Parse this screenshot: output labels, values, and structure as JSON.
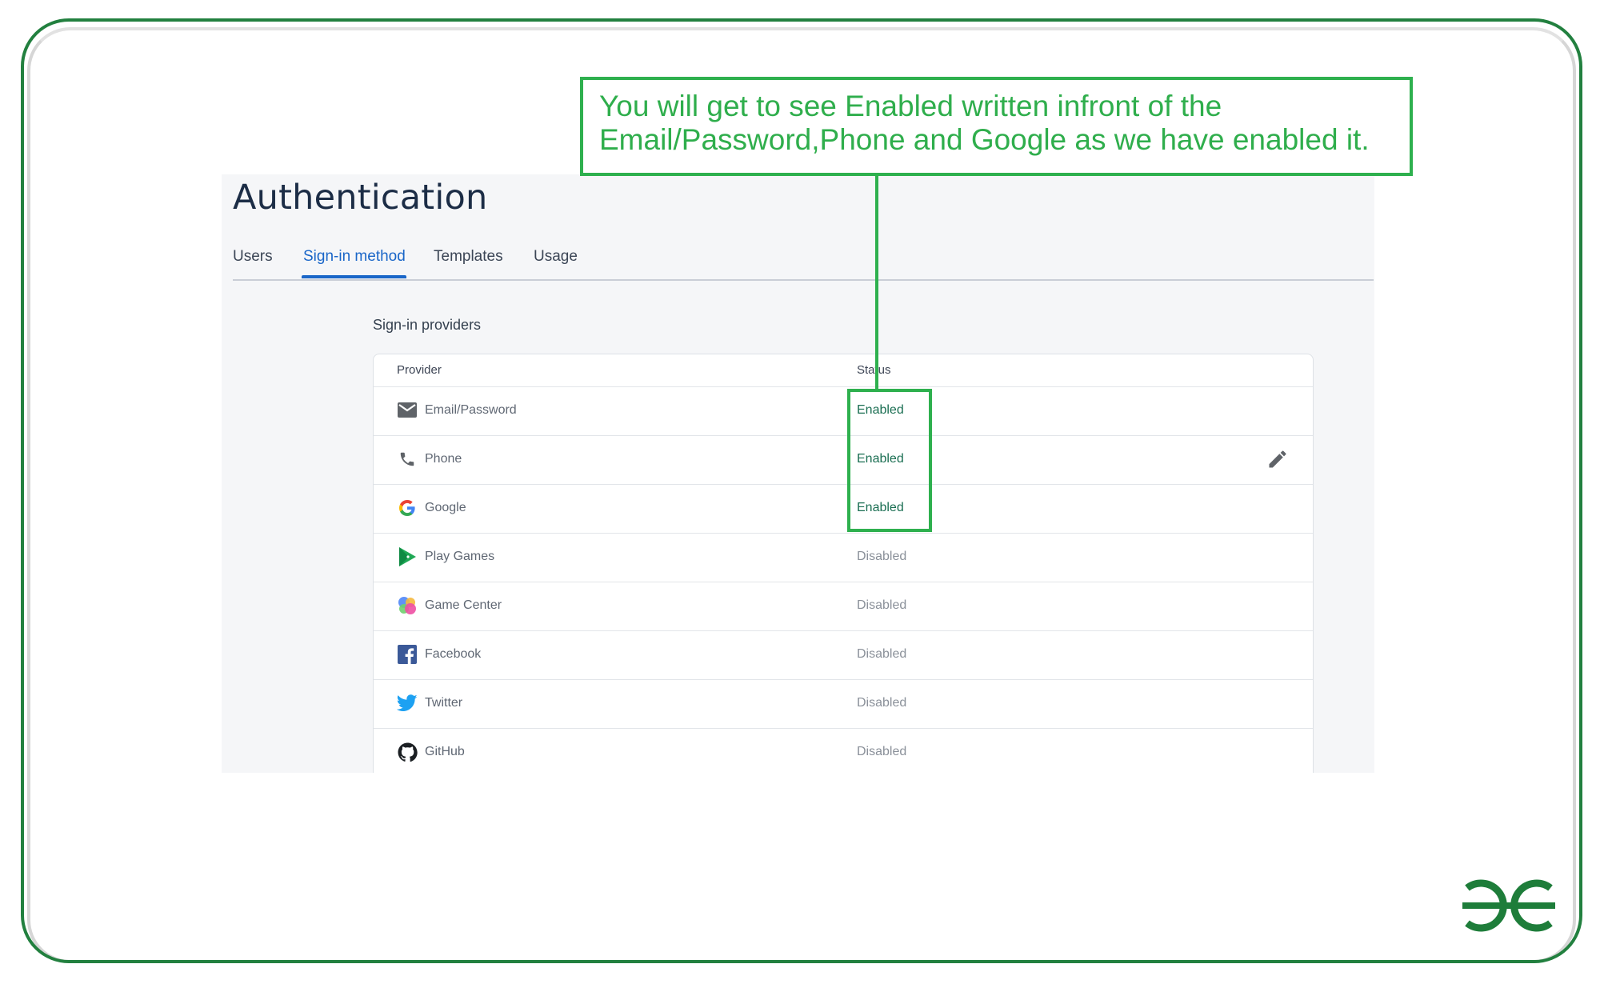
{
  "annotation": {
    "line1": "You will get to see Enabled written infront of the",
    "line2": "Email/Password,Phone and Google as we have enabled it.",
    "color": "#2eb04e"
  },
  "page": {
    "title": "Authentication",
    "tabs": [
      {
        "label": "Users",
        "active": false
      },
      {
        "label": "Sign-in method",
        "active": true
      },
      {
        "label": "Templates",
        "active": false
      },
      {
        "label": "Usage",
        "active": false
      }
    ],
    "section_label": "Sign-in providers",
    "table": {
      "headers": {
        "provider": "Provider",
        "status": "Status"
      },
      "rows": [
        {
          "icon": "mail-icon",
          "name": "Email/Password",
          "status": "Enabled"
        },
        {
          "icon": "phone-icon",
          "name": "Phone",
          "status": "Enabled"
        },
        {
          "icon": "google-icon",
          "name": "Google",
          "status": "Enabled"
        },
        {
          "icon": "play-games-icon",
          "name": "Play Games",
          "status": "Disabled"
        },
        {
          "icon": "game-center-icon",
          "name": "Game Center",
          "status": "Disabled"
        },
        {
          "icon": "facebook-icon",
          "name": "Facebook",
          "status": "Disabled"
        },
        {
          "icon": "twitter-icon",
          "name": "Twitter",
          "status": "Disabled"
        },
        {
          "icon": "github-icon",
          "name": "GitHub",
          "status": "Disabled"
        }
      ]
    },
    "colors": {
      "accent": "#1a66c8",
      "enabled": "#1a6e52",
      "disabled": "#8a9099",
      "frame": "#22803f"
    }
  },
  "brand": {
    "logo": "gfg-logo"
  }
}
